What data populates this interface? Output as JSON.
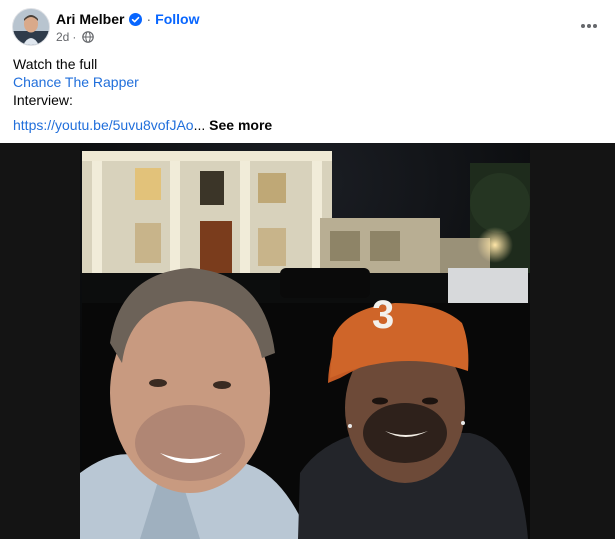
{
  "post": {
    "author": {
      "name": "Ari Melber",
      "verified_icon": "verified-badge-icon"
    },
    "follow_label": "Follow",
    "separator": "·",
    "timestamp": "2d",
    "audience_icon": "globe-icon",
    "caption": {
      "line1": "Watch the full",
      "mention": "Chance The Rapper",
      "line3": "Interview:",
      "link_text": "https://youtu.be/5uvu8vofJAo",
      "ellipsis": "...",
      "see_more": "See more"
    },
    "image": {
      "type": "photo"
    }
  },
  "colors": {
    "link": "#216fdb",
    "follow": "#0866ff",
    "verified": "#0866ff",
    "secondary_text": "#65676b"
  }
}
